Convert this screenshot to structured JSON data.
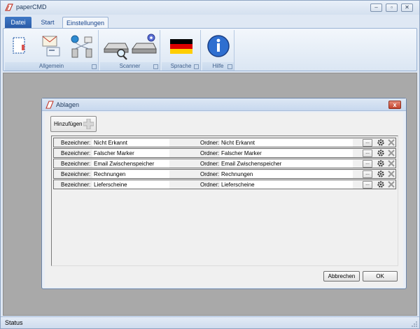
{
  "window": {
    "title": "paperCMD",
    "min": "–",
    "max": "▫",
    "close": "✕"
  },
  "tabs": [
    "Datei",
    "Start",
    "Einstellungen"
  ],
  "ribbon": {
    "groups": [
      {
        "label": "Allgemein"
      },
      {
        "label": "Scanner"
      },
      {
        "label": "Sprache"
      },
      {
        "label": "Hilfe"
      }
    ],
    "icons": [
      "document-frame-icon",
      "mail-settings-icon",
      "network-icon",
      "scanner-search-icon",
      "scanner-settings-icon",
      "german-flag-icon",
      "info-icon"
    ]
  },
  "dialog": {
    "title": "Ablagen",
    "close": "x",
    "add_label": "Hinzufügen",
    "label_bezeichner": "Bezeichner:",
    "label_ordner": "Ordner:",
    "browse_label": "...",
    "rows": [
      {
        "bezeichner": "Nicht Erkannt",
        "ordner": "Nicht Erkannt"
      },
      {
        "bezeichner": "Falscher Marker",
        "ordner": "Falscher Marker"
      },
      {
        "bezeichner": "Email Zwischenspeicher",
        "ordner": "Email Zwischenspeicher"
      },
      {
        "bezeichner": "Rechnungen",
        "ordner": "Rechnungen"
      },
      {
        "bezeichner": "Lieferscheine",
        "ordner": "Lieferscheine"
      }
    ],
    "cancel_label": "Abbrechen",
    "ok_label": "OK"
  },
  "status": {
    "text": "Status"
  },
  "colors": {
    "accent": "#2a5aa5",
    "ribbon_text": "#15428b",
    "workarea": "#a9a9a9"
  }
}
